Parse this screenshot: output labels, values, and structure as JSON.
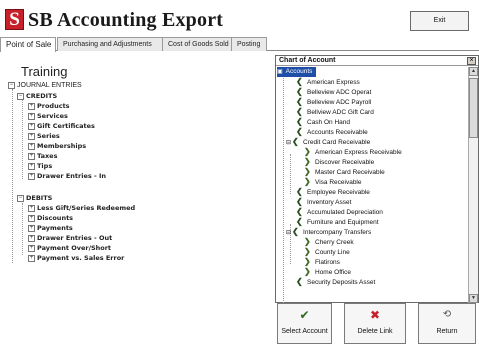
{
  "app": {
    "title": "SB Accounting Export",
    "logo_letter": "S",
    "exit_label": "Exit"
  },
  "tabs": [
    {
      "label": "Point of Sale",
      "active": true
    },
    {
      "label": "Purchasing and Adjustments",
      "active": false
    },
    {
      "label": "Cost of Goods Sold",
      "active": false
    },
    {
      "label": "Posting",
      "active": false
    }
  ],
  "company": "Training",
  "journal": {
    "root": "JOURNAL ENTRIES",
    "credits_label": "CREDITS",
    "credits": [
      "Products",
      "Services",
      "Gift Certificates",
      "Series",
      "Memberships",
      "Taxes",
      "Tips",
      "Drawer Entries - In"
    ],
    "debits_label": "DEBITS",
    "debits": [
      "Less Gift/Series Redeemed",
      "Discounts",
      "Payments",
      "Drawer Entries - Out",
      "Payment Over/Short",
      "Payment vs. Sales Error"
    ]
  },
  "coa": {
    "title": "Chart of Account",
    "close_symbol": "×",
    "root": "Accounts",
    "items": [
      "American Express",
      "Belleview ADC Operat",
      "Belleview ADC Payroll",
      "Bellview ADC Gift Card",
      "Cash On Hand",
      "Accounts Receivable",
      "Credit Card Receivable",
      "American Express Receivable",
      "Discover Receivable",
      "Master Card Receivable",
      "Visa Receivable",
      "Employee Receivable",
      "Inventory Asset",
      "Accumulated Depreciation",
      "Furniture and Equipment",
      "Intercompany Transfers",
      "Cherry Creek",
      "County Line",
      "Flatirons",
      "Home Office",
      "Security Deposits Asset"
    ]
  },
  "actions": {
    "select_label": "Select Account",
    "delete_label": "Delete Link",
    "return_label": "Return"
  },
  "colors": {
    "logo_red": "#c8202a",
    "selection_blue": "#1f4ea6",
    "chevron_green": "#2a4f1f"
  }
}
